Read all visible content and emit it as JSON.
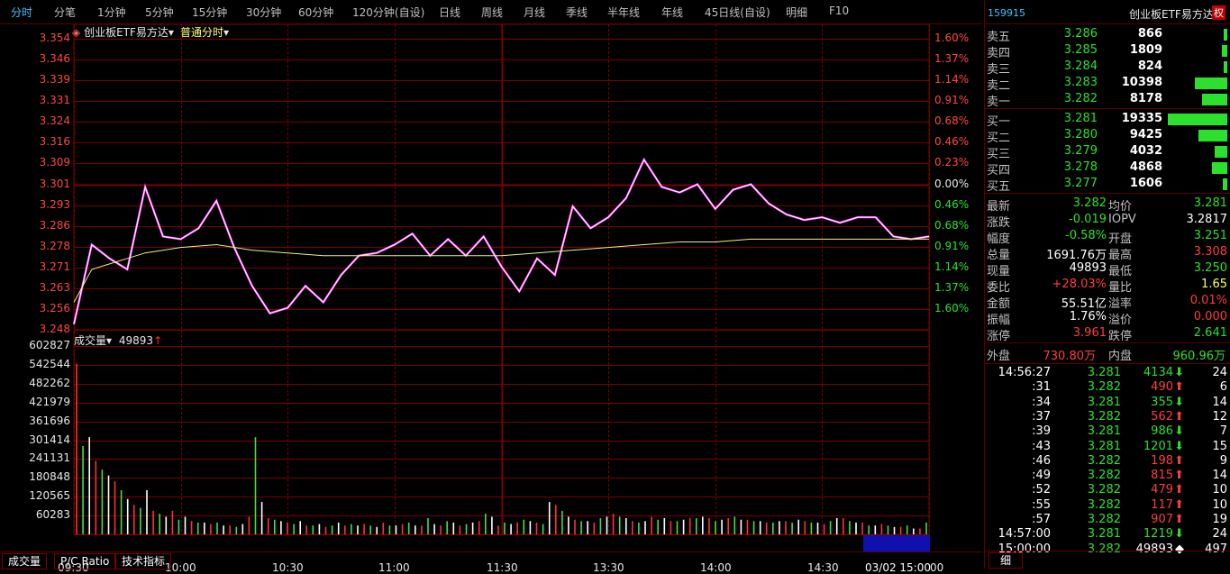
{
  "toolbar": {
    "tabs": [
      "分时",
      "分笔",
      "1分钟",
      "5分钟",
      "15分钟",
      "30分钟",
      "60分钟",
      "120分钟(自设)",
      "日线",
      "周线",
      "月线",
      "季线",
      "半年线",
      "年线",
      "45日线(自设)",
      "明细",
      "F10"
    ],
    "active": "分时"
  },
  "chart_header": {
    "security_label": "创业板ETF易方达",
    "mode_label": "普通分时",
    "volume_label": "成交量",
    "volume_value": "49893",
    "arrow": "↑"
  },
  "axes": {
    "price_labels": [
      "3.354",
      "3.346",
      "3.339",
      "3.331",
      "3.324",
      "3.316",
      "3.309",
      "3.301",
      "3.293",
      "3.286",
      "3.278",
      "3.271",
      "3.263",
      "3.256",
      "3.248"
    ],
    "pct_labels": [
      "1.60%",
      "1.37%",
      "1.14%",
      "0.91%",
      "0.68%",
      "0.46%",
      "0.23%",
      "0.00%",
      "0.46%",
      "0.68%",
      "0.91%",
      "1.14%",
      "1.37%",
      "1.60%"
    ],
    "volume_labels": [
      "602827",
      "542544",
      "482262",
      "421979",
      "361696",
      "301414",
      "241131",
      "180848",
      "120565",
      "60283"
    ],
    "time_labels": [
      "09:30",
      "10:00",
      "10:30",
      "11:00",
      "11:30",
      "13:30",
      "14:00",
      "14:30"
    ],
    "time_highlight": "03/02 15:00",
    "time_end": "00"
  },
  "chart_data": {
    "type": "line",
    "title": "",
    "x_range": [
      "09:30",
      "15:00"
    ],
    "ylim": [
      3.248,
      3.354
    ],
    "reference_price": 3.301,
    "series": [
      {
        "x": [
          0,
          5,
          10,
          15,
          20,
          25,
          30,
          35,
          40,
          45,
          50,
          55,
          60,
          65,
          70,
          75,
          80,
          85,
          90,
          95,
          100,
          105,
          110,
          115,
          120,
          125,
          130,
          135,
          140,
          145,
          150,
          155,
          160,
          165,
          170,
          175,
          180,
          185,
          190,
          195,
          200,
          205,
          210,
          215,
          220,
          225,
          230,
          235,
          240
        ],
        "values": [
          3.25,
          3.279,
          3.274,
          3.27,
          3.3,
          3.282,
          3.281,
          3.285,
          3.295,
          3.278,
          3.264,
          3.254,
          3.256,
          3.264,
          3.258,
          3.268,
          3.275,
          3.276,
          3.279,
          3.283,
          3.275,
          3.281,
          3.275,
          3.282,
          3.271,
          3.262,
          3.274,
          3.268,
          3.293,
          3.285,
          3.289,
          3.296,
          3.31,
          3.3,
          3.298,
          3.301,
          3.292,
          3.299,
          3.301,
          3.294,
          3.29,
          3.288,
          3.289,
          3.287,
          3.289,
          3.289,
          3.282,
          3.281,
          3.282
        ]
      },
      {
        "x": [
          0,
          5,
          10,
          15,
          20,
          30,
          40,
          50,
          60,
          70,
          80,
          90,
          100,
          110,
          120,
          130,
          140,
          150,
          160,
          170,
          180,
          190,
          200,
          210,
          220,
          230,
          240
        ],
        "values": [
          3.258,
          3.27,
          3.272,
          3.274,
          3.276,
          3.278,
          3.279,
          3.277,
          3.276,
          3.275,
          3.275,
          3.275,
          3.275,
          3.275,
          3.275,
          3.276,
          3.277,
          3.278,
          3.279,
          3.28,
          3.28,
          3.281,
          3.281,
          3.281,
          3.281,
          3.281,
          3.281
        ]
      }
    ],
    "volume_values": [
      580000,
      300000,
      330000,
      250000,
      220000,
      200000,
      180000,
      150000,
      120000,
      100000,
      90000,
      150000,
      80000,
      70000,
      60000,
      80000,
      50000,
      60000,
      45000,
      40000,
      40000,
      35000,
      40000,
      30000,
      30000,
      25000,
      35000,
      60000,
      330000,
      110000,
      55000,
      50000,
      45000,
      40000,
      35000,
      45000,
      30000,
      30000,
      35000,
      25000,
      30000,
      40000,
      30000,
      35000,
      30000,
      35000,
      30000,
      25000,
      40000,
      30000,
      30000,
      35000,
      40000,
      30000,
      30000,
      55000,
      35000,
      30000,
      45000,
      40000,
      30000,
      35000,
      40000,
      45000,
      70000,
      60000,
      30000,
      40000,
      35000,
      40000,
      50000,
      45000,
      40000,
      35000,
      110000,
      100000,
      80000,
      60000,
      50000,
      45000,
      45000,
      40000,
      55000,
      60000,
      70000,
      60000,
      55000,
      45000,
      40000,
      45000,
      60000,
      50000,
      55000,
      45000,
      45000,
      50000,
      55000,
      55000,
      60000,
      55000,
      45000,
      50000,
      55000,
      60000,
      50000,
      50000,
      45000,
      45000,
      40000,
      40000,
      45000,
      45000,
      40000,
      50000,
      45000,
      40000,
      40000,
      35000,
      45000,
      55000,
      55000,
      45000,
      40000,
      40000,
      30000,
      30000,
      35000,
      30000,
      25000,
      25000,
      30000,
      20000,
      20000,
      40000
    ]
  },
  "quote": {
    "code": "159915",
    "name": "创业板ETF易方达",
    "badge": "权",
    "asks": [
      {
        "label": "卖五",
        "price": "3.286",
        "vol": "866",
        "bar": 0.04
      },
      {
        "label": "卖四",
        "price": "3.285",
        "vol": "1809",
        "bar": 0.09
      },
      {
        "label": "卖三",
        "price": "3.284",
        "vol": "824",
        "bar": 0.04
      },
      {
        "label": "卖二",
        "price": "3.283",
        "vol": "10398",
        "bar": 0.54
      },
      {
        "label": "卖一",
        "price": "3.282",
        "vol": "8178",
        "bar": 0.42
      }
    ],
    "bids": [
      {
        "label": "买一",
        "price": "3.281",
        "vol": "19335",
        "bar": 1.0
      },
      {
        "label": "买二",
        "price": "3.280",
        "vol": "9425",
        "bar": 0.49
      },
      {
        "label": "买三",
        "price": "3.279",
        "vol": "4032",
        "bar": 0.21
      },
      {
        "label": "买四",
        "price": "3.278",
        "vol": "4868",
        "bar": 0.25
      },
      {
        "label": "买五",
        "price": "3.277",
        "vol": "1606",
        "bar": 0.08
      }
    ],
    "stats": [
      {
        "l1": "最新",
        "v1": "3.282",
        "c1": "green",
        "l2": "均价",
        "v2": "3.281",
        "c2": "green"
      },
      {
        "l1": "涨跌",
        "v1": "-0.019",
        "c1": "green",
        "l2": "IOPV",
        "v2": "3.2817",
        "c2": "white"
      },
      {
        "l1": "幅度",
        "v1": "-0.58%",
        "c1": "green",
        "l2": "开盘",
        "v2": "3.251",
        "c2": "green"
      },
      {
        "l1": "总量",
        "v1": "1691.76万",
        "c1": "white",
        "l2": "最高",
        "v2": "3.308",
        "c2": "red"
      },
      {
        "l1": "现量",
        "v1": "49893",
        "c1": "white",
        "l2": "最低",
        "v2": "3.250",
        "c2": "green"
      },
      {
        "l1": "委比",
        "v1": "+28.03%",
        "c1": "red",
        "l2": "量比",
        "v2": "1.65",
        "c2": "yellow"
      },
      {
        "l1": "金额",
        "v1": "55.51亿",
        "c1": "white",
        "l2": "溢率",
        "v2": "0.01%",
        "c2": "red"
      },
      {
        "l1": "振幅",
        "v1": "1.76%",
        "c1": "white",
        "l2": "溢价",
        "v2": "0.000",
        "c2": "red"
      },
      {
        "l1": "涨停",
        "v1": "3.961",
        "c1": "red",
        "l2": "跌停",
        "v2": "2.641",
        "c2": "green"
      }
    ],
    "outer_label": "外盘",
    "outer_value": "730.80万",
    "inner_label": "内盘",
    "inner_value": "960.96万",
    "ticks": [
      {
        "t": "14:56:27",
        "p": "3.281",
        "pc": "green",
        "v": "4134",
        "a": "⬇",
        "ac": "green",
        "n": "24"
      },
      {
        "t": ":31",
        "p": "3.282",
        "pc": "green",
        "v": "490",
        "a": "⬆",
        "ac": "red",
        "n": "6"
      },
      {
        "t": ":34",
        "p": "3.281",
        "pc": "green",
        "v": "355",
        "a": "⬇",
        "ac": "green",
        "n": "14"
      },
      {
        "t": ":37",
        "p": "3.282",
        "pc": "green",
        "v": "562",
        "a": "⬆",
        "ac": "red",
        "n": "12"
      },
      {
        "t": ":39",
        "p": "3.281",
        "pc": "green",
        "v": "986",
        "a": "⬇",
        "ac": "green",
        "n": "7"
      },
      {
        "t": ":43",
        "p": "3.281",
        "pc": "green",
        "v": "1201",
        "a": "⬇",
        "ac": "green",
        "n": "15"
      },
      {
        "t": ":46",
        "p": "3.282",
        "pc": "green",
        "v": "198",
        "a": "⬆",
        "ac": "red",
        "n": "9"
      },
      {
        "t": ":49",
        "p": "3.282",
        "pc": "green",
        "v": "815",
        "a": "⬆",
        "ac": "red",
        "n": "14"
      },
      {
        "t": ":52",
        "p": "3.282",
        "pc": "green",
        "v": "479",
        "a": "⬆",
        "ac": "red",
        "n": "10"
      },
      {
        "t": ":55",
        "p": "3.282",
        "pc": "green",
        "v": "117",
        "a": "⬆",
        "ac": "red",
        "n": "10"
      },
      {
        "t": ":57",
        "p": "3.282",
        "pc": "green",
        "v": "907",
        "a": "⬆",
        "ac": "red",
        "n": "19"
      },
      {
        "t": "14:57:00",
        "p": "3.281",
        "pc": "green",
        "v": "1219",
        "a": "⬇",
        "ac": "green",
        "n": "24"
      },
      {
        "t": "15:00:00",
        "p": "3.282",
        "pc": "green",
        "v": "49893",
        "a": "◆",
        "ac": "white",
        "n": "497"
      }
    ],
    "detail_tab": "细"
  },
  "bottom_tabs": [
    "成交量",
    "P/C Ratio",
    "技术指标"
  ],
  "colors": {
    "grid": "#7a0000",
    "price_line": "#ffffff",
    "price_line_glow": "#ff40ff",
    "avg_line": "#f0f080",
    "vol_up": "#ff3030",
    "vol_down": "#40e040",
    "vol_neutral": "#ffffff"
  }
}
